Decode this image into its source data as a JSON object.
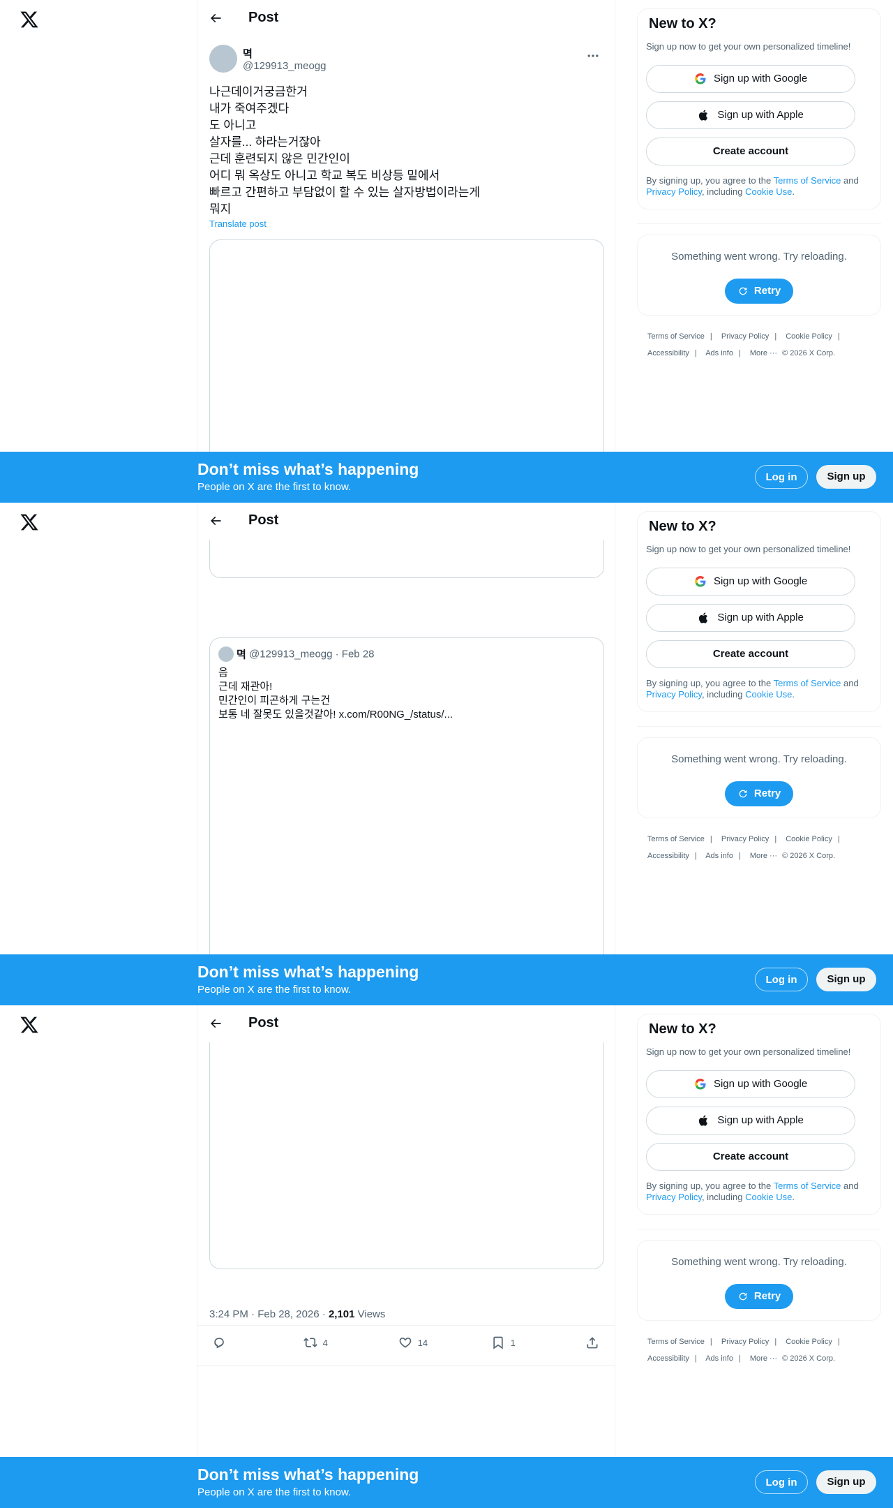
{
  "header": {
    "title": "Post"
  },
  "post": {
    "author_name": "멱",
    "author_handle": "@129913_meogg",
    "lines": [
      "나근데이거궁금한거",
      "내가 죽여주겠다",
      "도 아니고",
      "살자를... 하라는거잖아",
      "근데 훈련되지 않은 민간인이",
      "어디 뭐 옥상도 아니고 학교 복도 비상등 밑에서",
      "빠르고 간편하고 부담없이 할 수 있는 살자방법이라는게",
      "뭐지"
    ],
    "translate_label": "Translate post",
    "timestamp": "3:24 PM · Feb 28, 2026 · ",
    "views_count": "2,101",
    "views_label": " Views"
  },
  "quote": {
    "author_name": "멱",
    "meta": "@129913_meogg · Feb 28",
    "lines": [
      "음",
      "근데 재관아!",
      "민간인이 피곤하게 구는건",
      "보통 네 잘못도 있을것같아! x.com/R00NG_/status/..."
    ]
  },
  "actions": {
    "retweets": "4",
    "likes": "14",
    "bookmarks": "1"
  },
  "sidebar": {
    "signup_title": "New to X?",
    "signup_sub": "Sign up now to get your own personalized timeline!",
    "google_label": "Sign up with Google",
    "apple_label": "Sign up with Apple",
    "create_label": "Create account",
    "legal_prefix": "By signing up, you agree to the ",
    "terms_link": "Terms of Service",
    "legal_and": " and ",
    "privacy_link": "Privacy Policy",
    "legal_including": ", including ",
    "cookie_link": "Cookie Use",
    "legal_end": ".",
    "error_text": "Something went wrong. Try reloading.",
    "retry_label": "Retry"
  },
  "footer": {
    "terms": "Terms of Service",
    "privacy": "Privacy Policy",
    "cookie": "Cookie Policy",
    "accessibility": "Accessibility",
    "ads": "Ads info",
    "more": "More ···",
    "copyright": "© 2026 X Corp.",
    "separator": "|"
  },
  "banner": {
    "title": "Don’t miss what’s happening",
    "subtitle": "People on X are the first to know.",
    "login_label": "Log in",
    "signup_label": "Sign up"
  },
  "colors": {
    "accent": "#1d9bf0",
    "text": "#0f1419",
    "muted": "#536471",
    "border": "#eff3f4"
  },
  "icons": [
    "x-logo-icon",
    "back-arrow-icon",
    "more-icon",
    "google-icon",
    "apple-icon",
    "refresh-icon",
    "reply-icon",
    "retweet-icon",
    "like-icon",
    "bookmark-icon",
    "share-icon"
  ]
}
